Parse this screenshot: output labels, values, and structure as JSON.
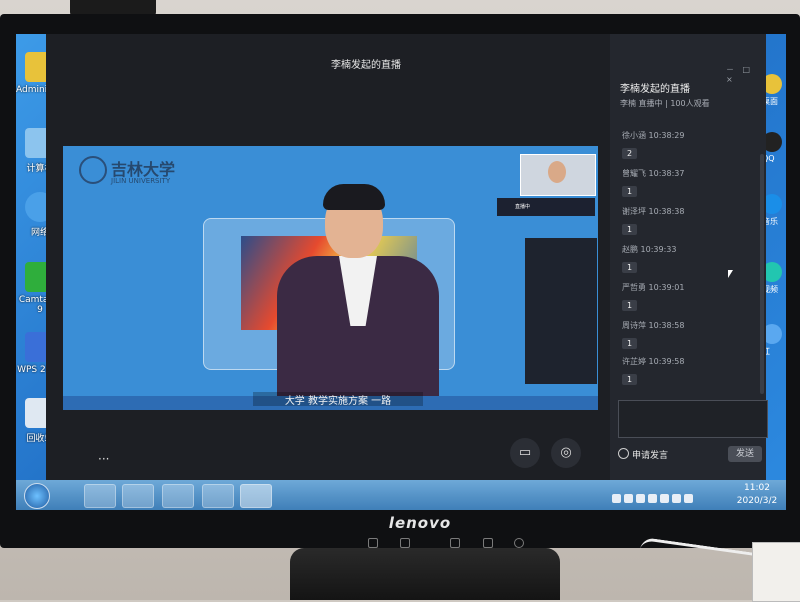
{
  "desktop": {
    "left_icons": [
      {
        "label": "Administr...",
        "icon": "user-folder-icon",
        "color": "#e8c23a"
      },
      {
        "label": "计算机",
        "icon": "computer-icon",
        "color": "#8cc4ee"
      },
      {
        "label": "网络",
        "icon": "network-icon",
        "color": "#4aa0e8"
      },
      {
        "label": "Camtasia 9",
        "icon": "camtasia-icon",
        "color": "#2fae3c"
      },
      {
        "label": "WPS 2019",
        "icon": "wps-icon",
        "color": "#3a6fd8"
      },
      {
        "label": "回收站",
        "icon": "recycle-bin-icon",
        "color": "#dfe8f2"
      }
    ],
    "right_icons": [
      {
        "label": "桌面",
        "icon": "desktop-app-icon"
      },
      {
        "label": "QQ",
        "icon": "qq-icon"
      },
      {
        "label": "音乐",
        "icon": "music-icon"
      },
      {
        "label": "视频",
        "icon": "video-icon"
      },
      {
        "label": "红",
        "icon": "red-app-icon"
      }
    ]
  },
  "live_window": {
    "title": "李楠发起的直播",
    "controls": "－ □ ×",
    "video": {
      "school_cn": "吉林大学",
      "school_en": "JILIN UNIVERSITY",
      "subtitle": "大学 教学实施方案 一路",
      "cam_status": "直播中"
    },
    "video_controls": [
      {
        "name": "folder-button",
        "icon": "▭"
      },
      {
        "name": "view-toggle-button",
        "icon": "◎"
      }
    ],
    "more_label": "···"
  },
  "chat": {
    "title": "李楠发起的直播",
    "subtitle": "李楠 直播中 | 100人观看",
    "messages": [
      {
        "user": "徐小涵",
        "time": "10:38:29",
        "text": "2"
      },
      {
        "user": "曾耀飞",
        "time": "10:38:37",
        "text": "1"
      },
      {
        "user": "谢泽坪",
        "time": "10:38:38",
        "text": "1"
      },
      {
        "user": "赵鹏",
        "time": "10:39:33",
        "text": "1"
      },
      {
        "user": "严哲勇",
        "time": "10:39:01",
        "text": "1"
      },
      {
        "user": "周诗萍",
        "time": "10:38:58",
        "text": "1"
      },
      {
        "user": "许芷婷",
        "time": "10:39:58",
        "text": "1"
      }
    ],
    "apply_label": "申请发言",
    "send_label": "发送"
  },
  "taskbar": {
    "time": "11:02",
    "date": "2020/3/2"
  },
  "monitor": {
    "brand": "lenovo"
  }
}
